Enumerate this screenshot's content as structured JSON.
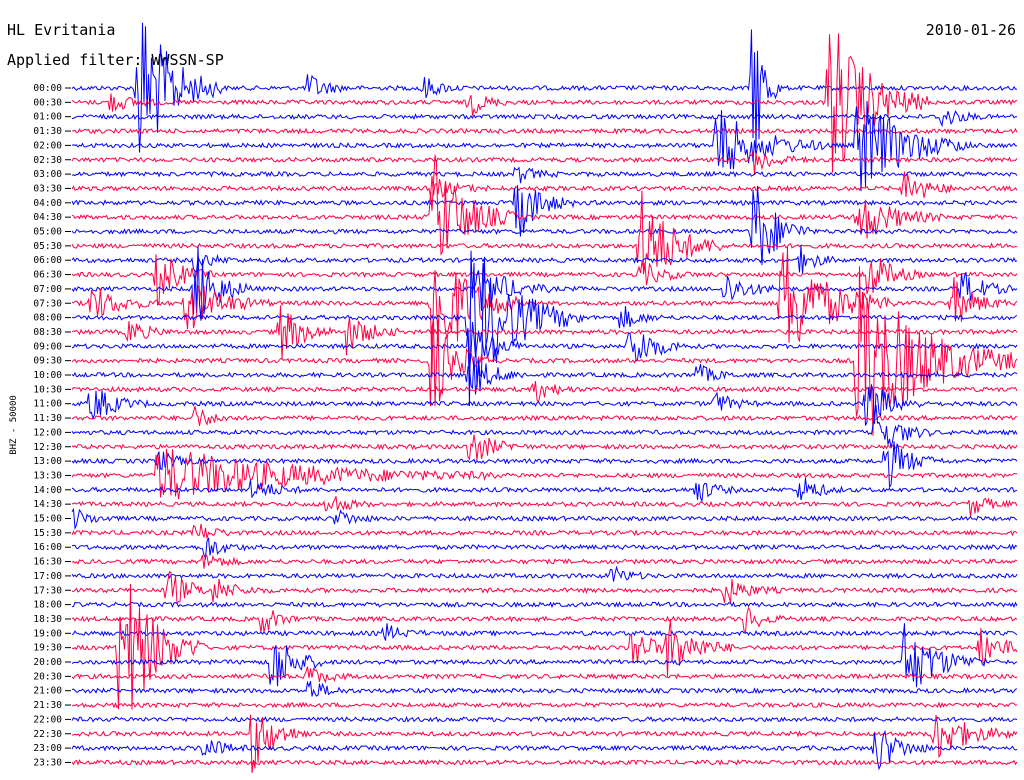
{
  "header": {
    "station": "HL Evritania",
    "date": "2010-01-26",
    "filter": "Applied filter: WWSSN-SP"
  },
  "chart_data": {
    "type": "helicorder",
    "ylabel": "BHZ - 50000",
    "colors": {
      "odd_rows": "#0000ff",
      "even_rows": "#ff0044"
    },
    "row_labels": [
      "00:00",
      "00:30",
      "01:00",
      "01:30",
      "02:00",
      "02:30",
      "03:00",
      "03:30",
      "04:00",
      "04:30",
      "05:00",
      "05:30",
      "06:00",
      "06:30",
      "07:00",
      "07:30",
      "08:00",
      "08:30",
      "09:00",
      "09:30",
      "10:00",
      "10:30",
      "11:00",
      "11:30",
      "12:00",
      "12:30",
      "13:00",
      "13:30",
      "14:00",
      "14:30",
      "15:00",
      "15:30",
      "16:00",
      "16:30",
      "17:00",
      "17:30",
      "18:00",
      "18:30",
      "19:00",
      "19:30",
      "20:00",
      "20:30",
      "21:00",
      "21:30",
      "22:00",
      "22:30",
      "23:00",
      "23:30"
    ],
    "minutes_per_row": 30,
    "events": [
      {
        "row": 0,
        "t": 0.07,
        "amp": 95,
        "dur": 0.03
      },
      {
        "row": 0,
        "t": 0.25,
        "amp": 16,
        "dur": 0.015
      },
      {
        "row": 0,
        "t": 0.37,
        "amp": 13,
        "dur": 0.015
      },
      {
        "row": 0,
        "t": 0.72,
        "amp": 100,
        "dur": 0.01
      },
      {
        "row": 1,
        "t": 0.04,
        "amp": 10,
        "dur": 0.02
      },
      {
        "row": 1,
        "t": 0.42,
        "amp": 14,
        "dur": 0.015
      },
      {
        "row": 1,
        "t": 0.8,
        "amp": 95,
        "dur": 0.035
      },
      {
        "row": 2,
        "t": 0.92,
        "amp": 12,
        "dur": 0.015
      },
      {
        "row": 4,
        "t": 0.68,
        "amp": 40,
        "dur": 0.04
      },
      {
        "row": 4,
        "t": 0.83,
        "amp": 60,
        "dur": 0.04
      },
      {
        "row": 5,
        "t": 0.72,
        "amp": 15,
        "dur": 0.02
      },
      {
        "row": 6,
        "t": 0.47,
        "amp": 10,
        "dur": 0.015
      },
      {
        "row": 7,
        "t": 0.88,
        "amp": 20,
        "dur": 0.02
      },
      {
        "row": 7,
        "t": 0.38,
        "amp": 12,
        "dur": 0.02
      },
      {
        "row": 8,
        "t": 0.47,
        "amp": 40,
        "dur": 0.02
      },
      {
        "row": 9,
        "t": 0.38,
        "amp": 70,
        "dur": 0.03
      },
      {
        "row": 9,
        "t": 0.83,
        "amp": 30,
        "dur": 0.03
      },
      {
        "row": 10,
        "t": 0.72,
        "amp": 60,
        "dur": 0.02
      },
      {
        "row": 11,
        "t": 0.6,
        "amp": 60,
        "dur": 0.03
      },
      {
        "row": 12,
        "t": 0.13,
        "amp": 12,
        "dur": 0.015
      },
      {
        "row": 12,
        "t": 0.77,
        "amp": 14,
        "dur": 0.015
      },
      {
        "row": 13,
        "t": 0.09,
        "amp": 30,
        "dur": 0.02
      },
      {
        "row": 13,
        "t": 0.6,
        "amp": 14,
        "dur": 0.02
      },
      {
        "row": 13,
        "t": 0.84,
        "amp": 30,
        "dur": 0.02
      },
      {
        "row": 14,
        "t": 0.13,
        "amp": 50,
        "dur": 0.02
      },
      {
        "row": 14,
        "t": 0.43,
        "amp": 30,
        "dur": 0.025
      },
      {
        "row": 14,
        "t": 0.69,
        "amp": 18,
        "dur": 0.02
      },
      {
        "row": 14,
        "t": 0.94,
        "amp": 20,
        "dur": 0.02
      },
      {
        "row": 15,
        "t": 0.02,
        "amp": 20,
        "dur": 0.025
      },
      {
        "row": 15,
        "t": 0.12,
        "amp": 30,
        "dur": 0.03
      },
      {
        "row": 15,
        "t": 0.38,
        "amp": 90,
        "dur": 0.03
      },
      {
        "row": 15,
        "t": 0.75,
        "amp": 70,
        "dur": 0.04
      },
      {
        "row": 15,
        "t": 0.93,
        "amp": 28,
        "dur": 0.02
      },
      {
        "row": 16,
        "t": 0.42,
        "amp": 90,
        "dur": 0.04
      },
      {
        "row": 16,
        "t": 0.58,
        "amp": 14,
        "dur": 0.015
      },
      {
        "row": 17,
        "t": 0.06,
        "amp": 14,
        "dur": 0.015
      },
      {
        "row": 17,
        "t": 0.22,
        "amp": 30,
        "dur": 0.02
      },
      {
        "row": 17,
        "t": 0.29,
        "amp": 22,
        "dur": 0.02
      },
      {
        "row": 18,
        "t": 0.42,
        "amp": 30,
        "dur": 0.02
      },
      {
        "row": 18,
        "t": 0.59,
        "amp": 30,
        "dur": 0.02
      },
      {
        "row": 19,
        "t": 0.38,
        "amp": 60,
        "dur": 0.02
      },
      {
        "row": 19,
        "t": 0.83,
        "amp": 100,
        "dur": 0.06
      },
      {
        "row": 20,
        "t": 0.42,
        "amp": 25,
        "dur": 0.02
      },
      {
        "row": 20,
        "t": 0.66,
        "amp": 12,
        "dur": 0.015
      },
      {
        "row": 21,
        "t": 0.49,
        "amp": 14,
        "dur": 0.015
      },
      {
        "row": 22,
        "t": 0.02,
        "amp": 22,
        "dur": 0.02
      },
      {
        "row": 22,
        "t": 0.68,
        "amp": 12,
        "dur": 0.015
      },
      {
        "row": 22,
        "t": 0.84,
        "amp": 30,
        "dur": 0.02
      },
      {
        "row": 23,
        "t": 0.13,
        "amp": 12,
        "dur": 0.015
      },
      {
        "row": 24,
        "t": 0.85,
        "amp": 30,
        "dur": 0.02
      },
      {
        "row": 25,
        "t": 0.42,
        "amp": 20,
        "dur": 0.02
      },
      {
        "row": 26,
        "t": 0.09,
        "amp": 12,
        "dur": 0.015
      },
      {
        "row": 26,
        "t": 0.86,
        "amp": 30,
        "dur": 0.02
      },
      {
        "row": 27,
        "t": 0.09,
        "amp": 30,
        "dur": 0.12
      },
      {
        "row": 28,
        "t": 0.19,
        "amp": 12,
        "dur": 0.02
      },
      {
        "row": 28,
        "t": 0.66,
        "amp": 14,
        "dur": 0.015
      },
      {
        "row": 28,
        "t": 0.77,
        "amp": 16,
        "dur": 0.015
      },
      {
        "row": 29,
        "t": 0.27,
        "amp": 14,
        "dur": 0.015
      },
      {
        "row": 29,
        "t": 0.95,
        "amp": 12,
        "dur": 0.015
      },
      {
        "row": 30,
        "t": 0.0,
        "amp": 12,
        "dur": 0.015
      },
      {
        "row": 30,
        "t": 0.28,
        "amp": 10,
        "dur": 0.015
      },
      {
        "row": 31,
        "t": 0.13,
        "amp": 12,
        "dur": 0.015
      },
      {
        "row": 32,
        "t": 0.14,
        "amp": 14,
        "dur": 0.015
      },
      {
        "row": 33,
        "t": 0.14,
        "amp": 10,
        "dur": 0.015
      },
      {
        "row": 34,
        "t": 0.57,
        "amp": 10,
        "dur": 0.015
      },
      {
        "row": 35,
        "t": 0.1,
        "amp": 22,
        "dur": 0.02
      },
      {
        "row": 35,
        "t": 0.15,
        "amp": 12,
        "dur": 0.02
      },
      {
        "row": 35,
        "t": 0.69,
        "amp": 14,
        "dur": 0.02
      },
      {
        "row": 37,
        "t": 0.2,
        "amp": 16,
        "dur": 0.015
      },
      {
        "row": 37,
        "t": 0.71,
        "amp": 16,
        "dur": 0.015
      },
      {
        "row": 38,
        "t": 0.33,
        "amp": 10,
        "dur": 0.015
      },
      {
        "row": 39,
        "t": 0.05,
        "amp": 100,
        "dur": 0.03
      },
      {
        "row": 39,
        "t": 0.59,
        "amp": 24,
        "dur": 0.02
      },
      {
        "row": 39,
        "t": 0.63,
        "amp": 30,
        "dur": 0.025
      },
      {
        "row": 39,
        "t": 0.96,
        "amp": 20,
        "dur": 0.02
      },
      {
        "row": 40,
        "t": 0.21,
        "amp": 40,
        "dur": 0.02
      },
      {
        "row": 40,
        "t": 0.88,
        "amp": 40,
        "dur": 0.03
      },
      {
        "row": 41,
        "t": 0.25,
        "amp": 12,
        "dur": 0.015
      },
      {
        "row": 42,
        "t": 0.25,
        "amp": 12,
        "dur": 0.015
      },
      {
        "row": 45,
        "t": 0.19,
        "amp": 40,
        "dur": 0.02
      },
      {
        "row": 45,
        "t": 0.91,
        "amp": 30,
        "dur": 0.03
      },
      {
        "row": 46,
        "t": 0.14,
        "amp": 14,
        "dur": 0.015
      },
      {
        "row": 46,
        "t": 0.85,
        "amp": 28,
        "dur": 0.02
      }
    ]
  }
}
